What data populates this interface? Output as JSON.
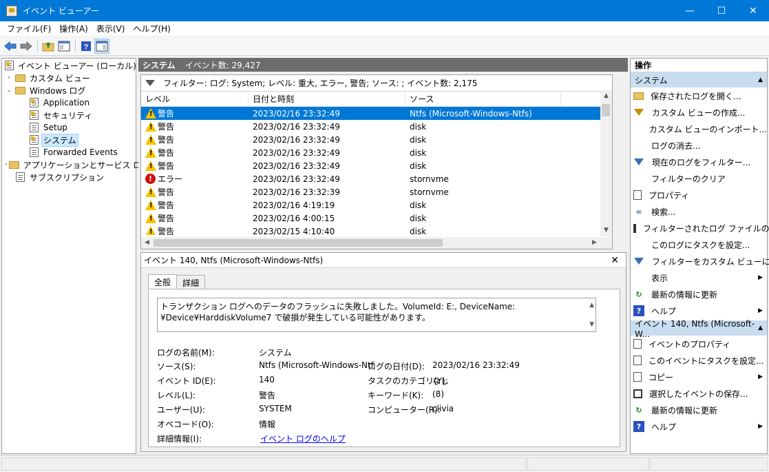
{
  "window": {
    "title": "イベント ビューアー",
    "minimize": "—",
    "maximize": "☐",
    "close": "✕"
  },
  "menu": [
    "ファイル(F)",
    "操作(A)",
    "表示(V)",
    "ヘルプ(H)"
  ],
  "tree": [
    {
      "label": "イベント ビューアー (ローカル)",
      "icon": "event-viewer-icon",
      "level": 0,
      "expander": ""
    },
    {
      "label": "カスタム ビュー",
      "icon": "folder-icon",
      "level": 1,
      "expander": "›"
    },
    {
      "label": "Windows ログ",
      "icon": "folder-icon",
      "level": 1,
      "expander": "⌄"
    },
    {
      "label": "Application",
      "icon": "log-icon",
      "level": 2,
      "expander": ""
    },
    {
      "label": "セキュリティ",
      "icon": "log-icon",
      "level": 2,
      "expander": ""
    },
    {
      "label": "Setup",
      "icon": "log-icon",
      "level": 2,
      "expander": ""
    },
    {
      "label": "システム",
      "icon": "log-icon",
      "level": 2,
      "expander": "",
      "selected": true
    },
    {
      "label": "Forwarded Events",
      "icon": "log-icon",
      "level": 2,
      "expander": ""
    },
    {
      "label": "アプリケーションとサービス ログ",
      "icon": "folder-icon",
      "level": 1,
      "expander": "›"
    },
    {
      "label": "サブスクリプション",
      "icon": "log-icon",
      "level": 1,
      "expander": ""
    }
  ],
  "center": {
    "log_name": "システム",
    "event_count": "イベント数: 29,427",
    "filter_text": "フィルター: ログ: System; レベル: 重大, エラー, 警告; ソース: ; イベント数: 2,175",
    "columns": [
      "レベル",
      "日付と時刻",
      "ソース"
    ],
    "rows": [
      {
        "level": "警告",
        "type": "warning",
        "datetime": "2023/02/16 23:32:49",
        "source": "Ntfs (Microsoft-Windows-Ntfs)",
        "selected": true
      },
      {
        "level": "警告",
        "type": "warning",
        "datetime": "2023/02/16 23:32:49",
        "source": "disk"
      },
      {
        "level": "警告",
        "type": "warning",
        "datetime": "2023/02/16 23:32:49",
        "source": "disk"
      },
      {
        "level": "警告",
        "type": "warning",
        "datetime": "2023/02/16 23:32:49",
        "source": "disk"
      },
      {
        "level": "警告",
        "type": "warning",
        "datetime": "2023/02/16 23:32:49",
        "source": "disk"
      },
      {
        "level": "エラー",
        "type": "error",
        "datetime": "2023/02/16 23:32:49",
        "source": "stornvme"
      },
      {
        "level": "警告",
        "type": "warning",
        "datetime": "2023/02/16 23:32:39",
        "source": "stornvme"
      },
      {
        "level": "警告",
        "type": "warning",
        "datetime": "2023/02/16 4:19:19",
        "source": "disk"
      },
      {
        "level": "警告",
        "type": "warning",
        "datetime": "2023/02/16 4:00:15",
        "source": "disk"
      },
      {
        "level": "警告",
        "type": "warning",
        "datetime": "2023/02/15 4:10:40",
        "source": "disk"
      }
    ]
  },
  "detail": {
    "title": "イベント 140, Ntfs (Microsoft-Windows-Ntfs)",
    "close": "✕",
    "tabs": [
      "全般",
      "詳細"
    ],
    "message": "トランザクション ログへのデータのフラッシュに失敗しました。VolumeId: E:, DeviceName: ¥Device¥HarddiskVolume7 で破損が発生している可能性があります。",
    "fields": {
      "log_name_label": "ログの名前(M):",
      "log_name": "システム",
      "source_label": "ソース(S):",
      "source": "Ntfs (Microsoft-Windows-Ntf",
      "logged_label": "ログの日付(D):",
      "logged": "2023/02/16 23:32:49",
      "event_id_label": "イベント ID(E):",
      "event_id": "140",
      "task_label": "タスクのカテゴリ(Y):",
      "task": "なし",
      "level_label": "レベル(L):",
      "level": "警告",
      "keywords_label": "キーワード(K):",
      "keywords": "(8)",
      "user_label": "ユーザー(U):",
      "user": "SYSTEM",
      "computer_label": "コンピューター(R):",
      "computer": "clivia",
      "opcode_label": "オペコード(O):",
      "opcode": "情報",
      "more_info_label": "詳細情報(I):",
      "more_info_link": "イベント ログのヘルプ"
    }
  },
  "actions": {
    "title": "操作",
    "section1": "システム",
    "items1": [
      {
        "label": "保存されたログを開く...",
        "icon": "open-folder-icon"
      },
      {
        "label": "カスタム ビューの作成...",
        "icon": "funnel-icon"
      },
      {
        "label": "カスタム ビューのインポート...",
        "icon": ""
      },
      {
        "label": "ログの消去...",
        "icon": ""
      },
      {
        "label": "現在のログをフィルター...",
        "icon": "funnel-blue-icon"
      },
      {
        "label": "フィルターのクリア",
        "icon": ""
      },
      {
        "label": "プロパティ",
        "icon": "properties-icon"
      },
      {
        "label": "検索...",
        "icon": "binoculars-icon"
      },
      {
        "label": "フィルターされたログ ファイルの...",
        "icon": "save-icon"
      },
      {
        "label": "このログにタスクを設定...",
        "icon": ""
      },
      {
        "label": "フィルターをカスタム ビューに保...",
        "icon": "save-filter-icon"
      },
      {
        "label": "表示",
        "icon": "",
        "submenu": true
      },
      {
        "label": "最新の情報に更新",
        "icon": "refresh-icon"
      },
      {
        "label": "ヘルプ",
        "icon": "help-icon",
        "submenu": true
      }
    ],
    "section2": "イベント 140, Ntfs (Microsoft-W...",
    "items2": [
      {
        "label": "イベントのプロパティ",
        "icon": "event-properties-icon"
      },
      {
        "label": "このイベントにタスクを設定...",
        "icon": "task-icon"
      },
      {
        "label": "コピー",
        "icon": "copy-icon",
        "submenu": true
      },
      {
        "label": "選択したイベントの保存...",
        "icon": "save-icon"
      },
      {
        "label": "最新の情報に更新",
        "icon": "refresh-icon"
      },
      {
        "label": "ヘルプ",
        "icon": "help-icon",
        "submenu": true
      }
    ]
  }
}
